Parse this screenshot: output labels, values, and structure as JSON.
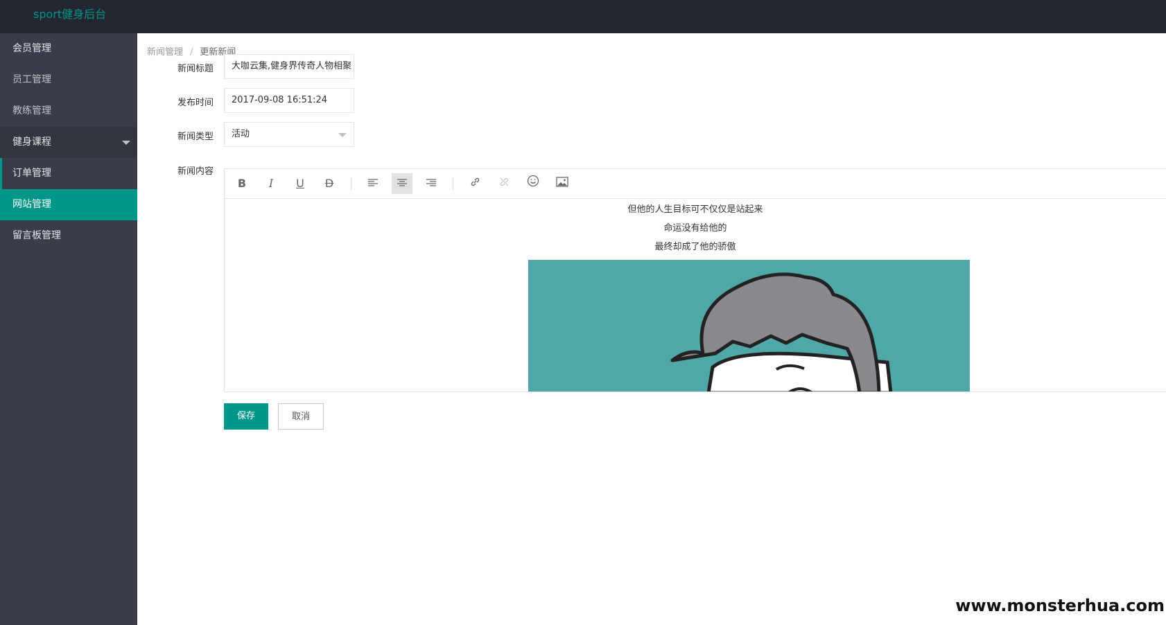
{
  "app": {
    "title": "sport健身后台"
  },
  "sidebar": {
    "items": [
      {
        "label": "会员管理"
      },
      {
        "label": "员工管理"
      },
      {
        "label": "教练管理"
      },
      {
        "label": "健身课程"
      },
      {
        "label": "订单管理"
      },
      {
        "label": "网站管理"
      },
      {
        "label": "留言板管理"
      }
    ]
  },
  "breadcrumb": {
    "parent": "新闻管理",
    "separator": "/",
    "current": "更新新闻"
  },
  "form": {
    "title_label": "新闻标题",
    "title_value": "大咖云集,健身界传奇人物相聚",
    "time_label": "发布时间",
    "time_value": "2017-09-08 16:51:24",
    "type_label": "新闻类型",
    "type_value": "活动",
    "content_label": "新闻内容"
  },
  "editor": {
    "toolbar": [
      "bold",
      "italic",
      "underline",
      "strikethrough",
      "align-left",
      "align-center",
      "align-right",
      "link",
      "unlink",
      "emoji",
      "image"
    ],
    "active_tool": "align-center",
    "paragraphs": [
      "但他的人生目标可不仅仅是站起来",
      "命运没有给他的",
      "最终却成了他的骄傲"
    ]
  },
  "buttons": {
    "save": "保存",
    "cancel": "取消"
  },
  "watermark": "www.monsterhua.com",
  "colors": {
    "accent": "#009688",
    "topbar": "#23262e",
    "sidebar": "#393d49",
    "image_bg": "#4fa7a7"
  }
}
